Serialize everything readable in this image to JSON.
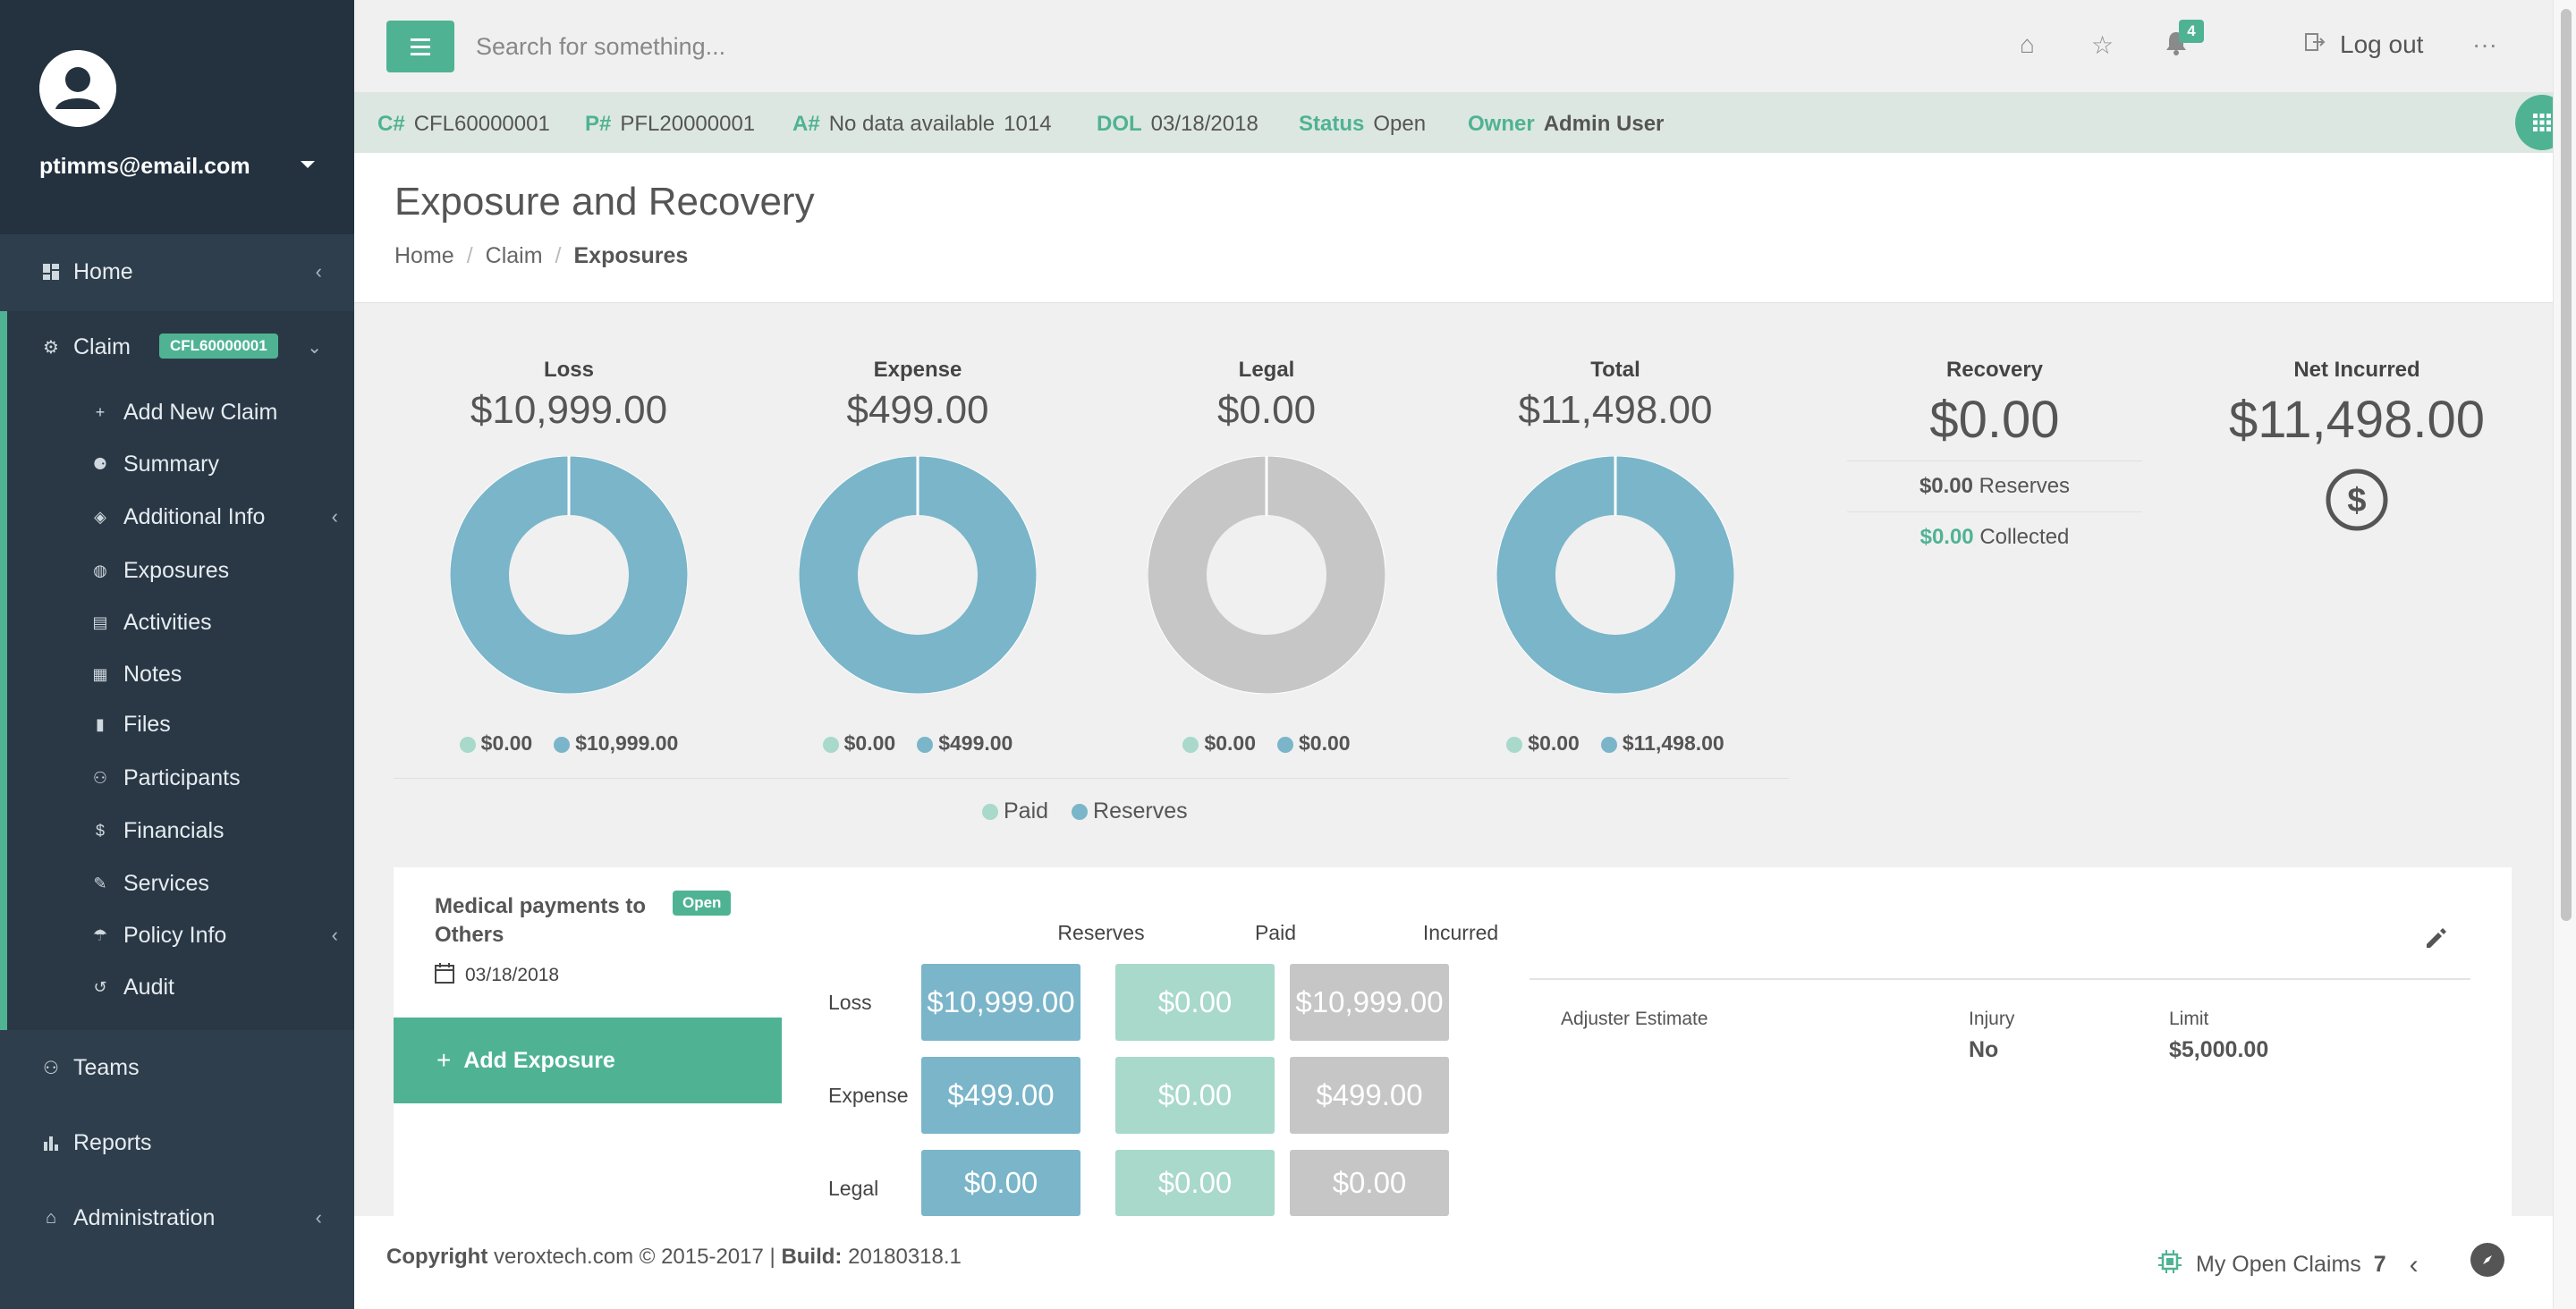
{
  "sidebar": {
    "user_email": "ptimms@email.com",
    "items": [
      {
        "label": "Home"
      },
      {
        "label": "Claim",
        "badge": "CFL60000001"
      },
      {
        "label": "Teams"
      },
      {
        "label": "Reports"
      },
      {
        "label": "Administration"
      }
    ],
    "claim_sub_items": [
      {
        "label": "Add New Claim"
      },
      {
        "label": "Summary"
      },
      {
        "label": "Additional Info"
      },
      {
        "label": "Exposures"
      },
      {
        "label": "Activities"
      },
      {
        "label": "Notes"
      },
      {
        "label": "Files"
      },
      {
        "label": "Participants"
      },
      {
        "label": "Financials"
      },
      {
        "label": "Services"
      },
      {
        "label": "Policy Info"
      },
      {
        "label": "Audit"
      }
    ]
  },
  "topbar": {
    "search_placeholder": "Search for something...",
    "notification_count": "4",
    "logout_label": "Log out"
  },
  "infobar": {
    "claim_key": "C#",
    "claim_val": "CFL60000001",
    "policy_key": "P#",
    "policy_val": "PFL20000001",
    "account_key": "A#",
    "account_val": "No data available",
    "account_num": "1014",
    "dol_key": "DOL",
    "dol_val": "03/18/2018",
    "status_key": "Status",
    "status_val": "Open",
    "owner_key": "Owner",
    "owner_val": "Admin User"
  },
  "page": {
    "title": "Exposure and Recovery",
    "breadcrumb": [
      "Home",
      "Claim",
      "Exposures"
    ]
  },
  "summary": {
    "cards": [
      {
        "title": "Loss",
        "amount": "$10,999.00",
        "paid": "$0.00",
        "reserves": "$10,999.00",
        "paid_fraction": 0.0
      },
      {
        "title": "Expense",
        "amount": "$499.00",
        "paid": "$0.00",
        "reserves": "$499.00",
        "paid_fraction": 0.0
      },
      {
        "title": "Legal",
        "amount": "$0.00",
        "paid": "$0.00",
        "reserves": "$0.00",
        "paid_fraction": 0.0
      },
      {
        "title": "Total",
        "amount": "$11,498.00",
        "paid": "$0.00",
        "reserves": "$11,498.00",
        "paid_fraction": 0.0
      }
    ],
    "recovery": {
      "title": "Recovery",
      "amount": "$0.00",
      "reserves_amount": "$0.00",
      "reserves_label": "Reserves",
      "collected_amount": "$0.00",
      "collected_label": "Collected"
    },
    "net_incurred": {
      "title": "Net Incurred",
      "amount": "$11,498.00"
    },
    "legend": {
      "paid": "Paid",
      "reserves": "Reserves"
    }
  },
  "exposure": {
    "name": "Medical payments to Others",
    "status": "Open",
    "date": "03/18/2018",
    "add_label": "Add Exposure",
    "columns": [
      "Reserves",
      "Paid",
      "Incurred"
    ],
    "rows": [
      {
        "label": "Loss",
        "reserves": "$10,999.00",
        "paid": "$0.00",
        "incurred": "$10,999.00"
      },
      {
        "label": "Expense",
        "reserves": "$499.00",
        "paid": "$0.00",
        "incurred": "$499.00"
      },
      {
        "label": "Legal",
        "reserves": "$0.00",
        "paid": "$0.00",
        "incurred": "$0.00"
      }
    ],
    "details": {
      "adjuster_label": "Adjuster Estimate",
      "injury_label": "Injury",
      "injury_val": "No",
      "limit_label": "Limit",
      "limit_val": "$5,000.00"
    }
  },
  "footer": {
    "copyright_label": "Copyright",
    "copyright_text": "veroxtech.com © 2015-2017 |",
    "build_label": "Build:",
    "build_val": "20180318.1",
    "my_open_claims_label": "My Open Claims",
    "my_open_claims_count": "7"
  },
  "colors": {
    "accent": "#4fb393",
    "sidebar": "#2f3e4c",
    "reserves": "#7ab5c9",
    "paid": "#a8d9cb",
    "neutral": "#c6c6c6"
  }
}
